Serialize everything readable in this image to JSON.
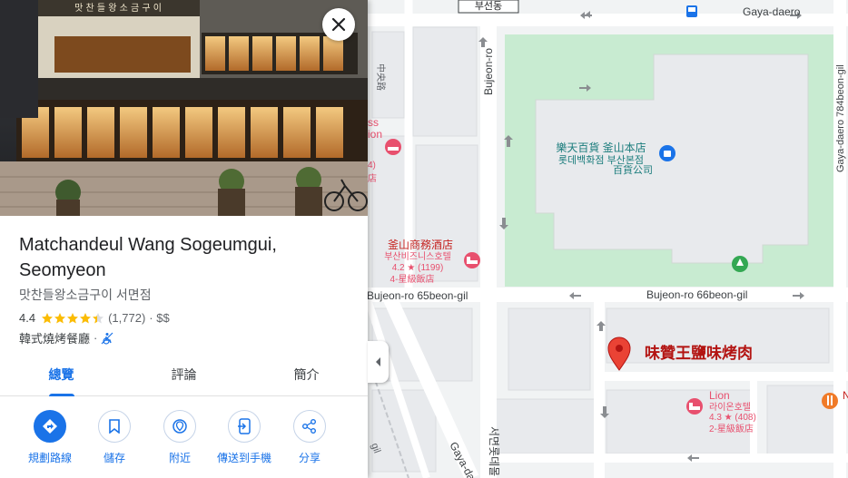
{
  "place": {
    "name": "Matchandeul Wang Sogeumgui, Seomyeon",
    "local_name": "맛찬들왕소금구이 서면점",
    "rating": "4.4",
    "star_count": 4.4,
    "review_count": "(1,772)",
    "price": "· $$",
    "category": "韓式燒烤餐廳",
    "sign_text": "맛 찬 들 왕 소 금 구 이"
  },
  "tabs": [
    {
      "label": "總覽",
      "active": true
    },
    {
      "label": "評論",
      "active": false
    },
    {
      "label": "簡介",
      "active": false
    }
  ],
  "actions": [
    {
      "label": "規劃路線",
      "icon": "directions-icon"
    },
    {
      "label": "儲存",
      "icon": "bookmark-icon"
    },
    {
      "label": "附近",
      "icon": "nearby-icon"
    },
    {
      "label": "傳送到手機",
      "icon": "send-to-phone-icon"
    },
    {
      "label": "分享",
      "icon": "share-icon"
    }
  ],
  "map": {
    "streets": {
      "busandong": "부선동",
      "gaya_daero": "Gaya-daero",
      "bujeon_ro": "Bujeon-ro",
      "gaya_daero_784": "Gaya-daero 784beon-gil",
      "bujeon_ro_65": "Bujeon-ro 65beon-gil",
      "bujeon_ro_66": "Bujeon-ro 66beon-gil",
      "gaya_daero_lower": "Gaya-dae",
      "side_vertical": "中央路",
      "bottom_lane": "gil"
    },
    "pois": {
      "lotte_name": "樂天百貨 釜山本店",
      "lotte_ko_1": "롯데백화점 부산본점",
      "lotte_ko_2": "百貨公司",
      "hotel_business_name": "釜山商務酒店",
      "hotel_business_ko": "부산비즈니스호텔",
      "hotel_business_rating": "4.2 ★ (1199)",
      "hotel_business_class": "4-星級飯店",
      "hotel_lion_name": "Lion",
      "hotel_lion_ko": "라이온호텔",
      "hotel_lion_rating": "4.3 ★ (408)",
      "hotel_lion_class": "2-星級飯店",
      "selected_label": "味贊王鹽味烤肉",
      "left_partial_1": "ss",
      "left_partial_2": "ion",
      "left_partial_3": "4)",
      "left_partial_4": "店",
      "right_partial": "N",
      "bottom_building": "서면롯데몰"
    },
    "colors": {
      "road": "#ffffff",
      "block": "#e8eaed",
      "park": "#c8ebd1",
      "park_dark": "#8fd6a3",
      "hotel_pink": "#e8506e",
      "pin_red": "#d93025",
      "poi_teal": "#1a8a8a",
      "selected_text": "#b31412"
    }
  }
}
